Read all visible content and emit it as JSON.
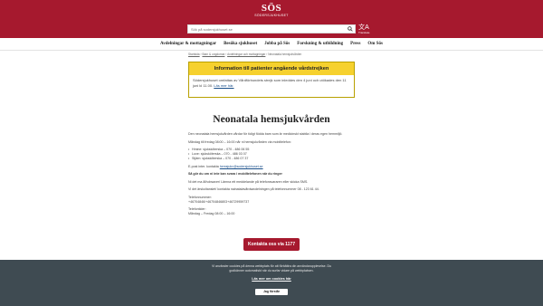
{
  "header": {
    "logo_text": "SÖS",
    "logo_subtext": "SÖDERSJUKHUSET",
    "search_placeholder": "Sök på sodersjukhuset.se",
    "translate_label": "Translate",
    "translate_glyph": "文A"
  },
  "nav": {
    "items": [
      "Avdelningar & mottagningar",
      "Besöka sjukhuset",
      "Jobba på Sös",
      "Forskning & utbildning",
      "Press",
      "Om Sös"
    ]
  },
  "breadcrumbs": [
    "Startsida",
    "Barn & ungdomar",
    "Avdelningar och mottagningar",
    "Neonatala hemsjukvården"
  ],
  "alert": {
    "title": "Information till patienter angående vårdstrejken",
    "body": "Södersjukhuset omfattas av Vårdförbundets strejk som inleddes den 4 juni och utökades den 11 juni kl 11.00.",
    "link": "Läs mer här."
  },
  "content": {
    "title": "Neonatala hemsjukvården",
    "intro": "Den neonatala hemsjukvården vårdar för tidigt födda barn som är medicinskt stabila i deras egen hemmiljö.",
    "hours": "Måndag till fredag 08:00 – 16:00 når ni hemsjukvården via mobiltelefon:",
    "phones": [
      "Hmine: sjuksköterska – 070 - 486 06 55",
      "Luxe: sjuksköterska – 070 - 486 03 07",
      "Stjärn: sjuksköterska – 070 - 486 07 37"
    ],
    "email_prefix": "E-post inter. kontakta",
    "email_link": "hemsjukv@sodersjukhuset.se",
    "heading_2": "Så gör du om ni inte kan svara i mobiltelefonen när du ringer",
    "para_2": "Ni det ma å/hobsaver/ Lämna ett meddelande på telefonsvararen eller skicka SMS.",
    "para_3": "Vi det ärskoltanslet/ kontakta nainatalavårdsavdelningen på telefonnummer 08 - 123 61 44.",
    "tel_label": "Telefonnummer:",
    "tel_value": "+46704846/+46704846803+46729959737",
    "tel_label_2": "Telefontider:",
    "tel_value_2": "Måndag – Fredag 08:00 – 16:00"
  },
  "cta": {
    "label": "Kontakta oss via 1177"
  },
  "cookie": {
    "text": "Vi använder cookies på denna webbplats för att förbättra din användarupplevelse. Du godkänner automatiskt när du surfar vidare på webbplatsen.",
    "more_link": "Läs mer om cookies här",
    "accept_label": "Jag förstår"
  }
}
